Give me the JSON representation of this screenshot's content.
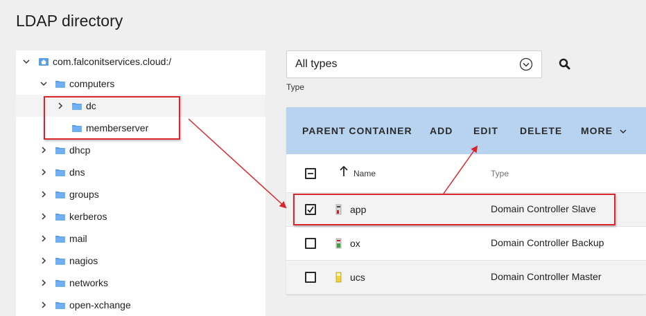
{
  "page": {
    "title": "LDAP directory"
  },
  "tree": {
    "items": [
      {
        "label": "com.falconitservices.cloud:/",
        "expanded": true,
        "icon": "domain-icon"
      },
      {
        "label": "computers",
        "expanded": true,
        "icon": "folder-icon"
      },
      {
        "label": "dc",
        "expanded": false,
        "icon": "folder-icon"
      },
      {
        "label": "memberserver",
        "icon": "folder-icon"
      },
      {
        "label": "dhcp",
        "expanded": false,
        "icon": "folder-icon"
      },
      {
        "label": "dns",
        "expanded": false,
        "icon": "folder-icon"
      },
      {
        "label": "groups",
        "expanded": false,
        "icon": "folder-icon"
      },
      {
        "label": "kerberos",
        "expanded": false,
        "icon": "folder-icon"
      },
      {
        "label": "mail",
        "expanded": false,
        "icon": "folder-icon"
      },
      {
        "label": "nagios",
        "expanded": false,
        "icon": "folder-icon"
      },
      {
        "label": "networks",
        "expanded": false,
        "icon": "folder-icon"
      },
      {
        "label": "open-xchange",
        "expanded": false,
        "icon": "folder-icon"
      }
    ]
  },
  "filter": {
    "type_value": "All types",
    "type_caption": "Type"
  },
  "toolbar": {
    "parent_container": "PARENT CONTAINER",
    "add": "ADD",
    "edit": "EDIT",
    "delete": "DELETE",
    "more": "MORE"
  },
  "grid": {
    "columns": {
      "name": "Name",
      "type": "Type"
    },
    "rows": [
      {
        "name": "app",
        "type": "Domain Controller Slave",
        "checked": true
      },
      {
        "name": "ox",
        "type": "Domain Controller Backup",
        "checked": false
      },
      {
        "name": "ucs",
        "type": "Domain Controller Master",
        "checked": false
      }
    ]
  },
  "colors": {
    "toolbar_bg": "#b8d3ef",
    "highlight": "#d9262c",
    "folder": "#5a9ee6"
  }
}
